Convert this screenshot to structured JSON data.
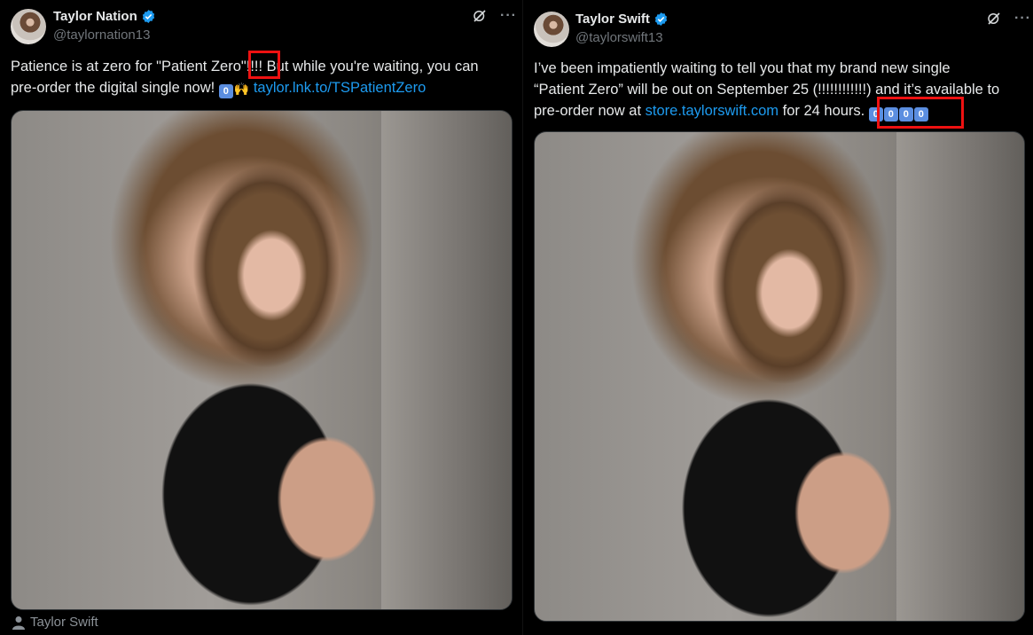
{
  "left_tweet": {
    "name": "Taylor Nation",
    "handle": "@taylornation13",
    "text_part1": "Patience is at zero for \"Patient Zero\"!!!! But while you're waiting, you can",
    "text_part2": "pre-order the digital single now!",
    "keycap": "0",
    "emoji_hands": "🙌",
    "link": "taylor.lnk.to/TSPatientZero",
    "tagged_label": "Taylor Swift"
  },
  "right_tweet": {
    "name": "Taylor Swift",
    "handle": "@taylorswift13",
    "line1": "I’ve been impatiently waiting to tell you that my brand new single",
    "line2": "“Patient Zero” will be out on September 25 (!!!!!!!!!!!!) and it’s available to",
    "line3_prefix": "pre-order now at",
    "link": "store.taylorswift.com",
    "line3_suffix": "for 24 hours.",
    "keycaps": [
      "0",
      "0",
      "0",
      "0"
    ]
  },
  "icons": {
    "verified": "verified-badge-icon",
    "grok": "grok-icon",
    "more": "more-icon",
    "person": "person-icon"
  },
  "colors": {
    "link": "#1d9bf0",
    "verified": "#1d9bf0",
    "highlight": "#ee1111",
    "background": "#000000"
  }
}
